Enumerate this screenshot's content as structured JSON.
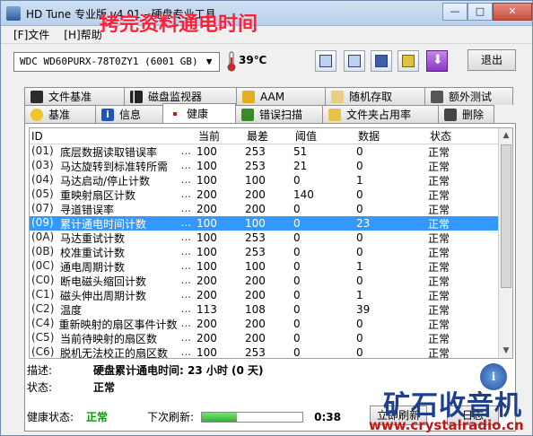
{
  "window": {
    "title": "HD Tune 专业版 v4.01 - 硬盘专业工具"
  },
  "overlay_caption": "拷完资料通电时间",
  "menu": {
    "file": "[F]文件",
    "help": "[H]帮助"
  },
  "toolbar": {
    "drive": "WDC WD60PURX-78T0ZY1 (6001 GB)",
    "temperature": "39℃",
    "exit_label": "退出"
  },
  "tabs_top": [
    "文件基准",
    "磁盘监视器",
    "AAM",
    "随机存取",
    "额外测试"
  ],
  "tabs_bottom": [
    "基准",
    "信息",
    "健康",
    "错误扫描",
    "文件夹占用率",
    "删除"
  ],
  "list": {
    "headers": {
      "id": "ID",
      "current": "当前",
      "worst": "最差",
      "threshold": "阈值",
      "data": "数据",
      "status": "状态"
    },
    "rows": [
      {
        "code": "(01)",
        "name": "底层数据读取错误率",
        "current": "100",
        "worst": "253",
        "threshold": "51",
        "data": "0",
        "status": "正常"
      },
      {
        "code": "(03)",
        "name": "马达旋转到标准转所需",
        "current": "100",
        "worst": "253",
        "threshold": "21",
        "data": "0",
        "status": "正常"
      },
      {
        "code": "(04)",
        "name": "马达启动/停止计数",
        "current": "100",
        "worst": "100",
        "threshold": "0",
        "data": "1",
        "status": "正常"
      },
      {
        "code": "(05)",
        "name": "重映射扇区计数",
        "current": "200",
        "worst": "200",
        "threshold": "140",
        "data": "0",
        "status": "正常"
      },
      {
        "code": "(07)",
        "name": "寻道错误率",
        "current": "200",
        "worst": "200",
        "threshold": "0",
        "data": "0",
        "status": "正常"
      },
      {
        "code": "(09)",
        "name": "累计通电时间计数",
        "current": "100",
        "worst": "100",
        "threshold": "0",
        "data": "23",
        "status": "正常"
      },
      {
        "code": "(0A)",
        "name": "马达重试计数",
        "current": "100",
        "worst": "253",
        "threshold": "0",
        "data": "0",
        "status": "正常"
      },
      {
        "code": "(0B)",
        "name": "校准重试计数",
        "current": "100",
        "worst": "253",
        "threshold": "0",
        "data": "0",
        "status": "正常"
      },
      {
        "code": "(0C)",
        "name": "通电周期计数",
        "current": "100",
        "worst": "100",
        "threshold": "0",
        "data": "1",
        "status": "正常"
      },
      {
        "code": "(C0)",
        "name": "断电磁头缩回计数",
        "current": "200",
        "worst": "200",
        "threshold": "0",
        "data": "0",
        "status": "正常"
      },
      {
        "code": "(C1)",
        "name": "磁头伸出周期计数",
        "current": "200",
        "worst": "200",
        "threshold": "0",
        "data": "1",
        "status": "正常"
      },
      {
        "code": "(C2)",
        "name": "温度",
        "current": "113",
        "worst": "108",
        "threshold": "0",
        "data": "39",
        "status": "正常"
      },
      {
        "code": "(C4)",
        "name": "重新映射的扇区事件计数",
        "current": "200",
        "worst": "200",
        "threshold": "0",
        "data": "0",
        "status": "正常"
      },
      {
        "code": "(C5)",
        "name": "当前待映射的扇区数",
        "current": "200",
        "worst": "200",
        "threshold": "0",
        "data": "0",
        "status": "正常"
      },
      {
        "code": "(C6)",
        "name": "脱机无法校正的扇区数",
        "current": "100",
        "worst": "253",
        "threshold": "0",
        "data": "0",
        "status": "正常"
      }
    ],
    "selected_index": 5
  },
  "description": {
    "label": "描述:",
    "value": "硬盘累计通电时间: 23 小时 (0 天)"
  },
  "state": {
    "label": "状态:",
    "value": "正常"
  },
  "health": {
    "label": "健康状态:",
    "value": "正常",
    "next_refresh_label": "下次刷新:",
    "progress": 0.35,
    "countdown": "0:38"
  },
  "buttons": {
    "refresh": "立即刷新",
    "log": "日志"
  },
  "watermark": {
    "big": "矿石收音机",
    "url": "www.crystalradio.cn"
  }
}
